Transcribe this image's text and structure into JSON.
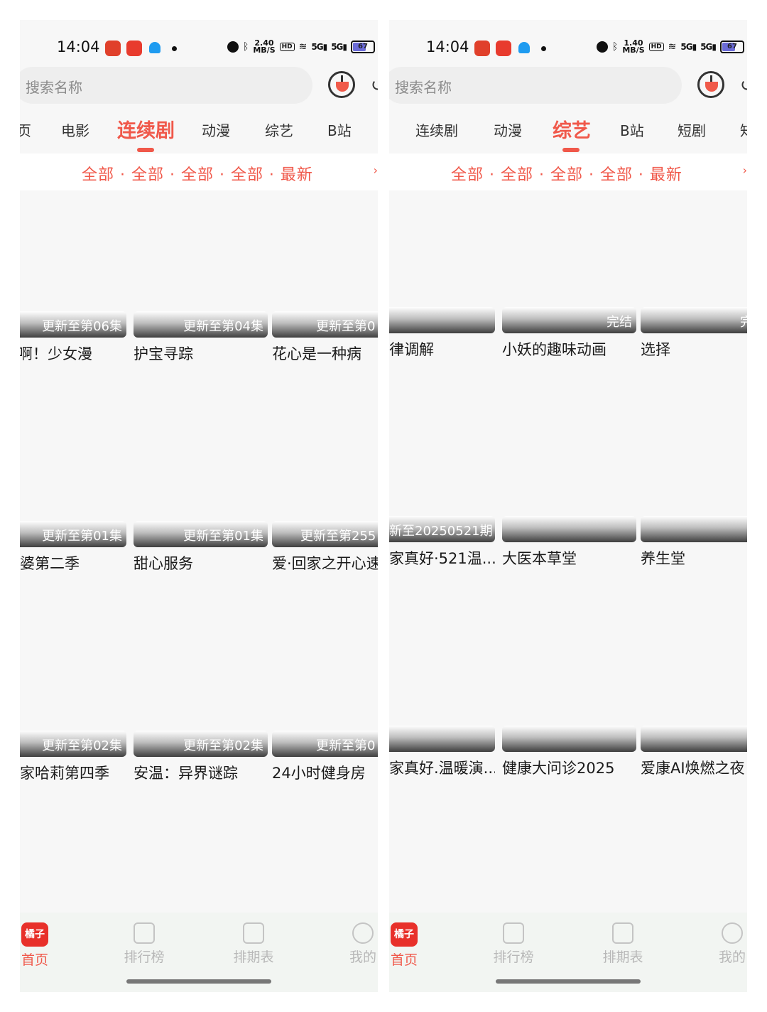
{
  "screens": [
    {
      "status": {
        "time": "14:04",
        "speed": "2.40",
        "speed_unit": "MB/S",
        "hd": "HD",
        "sig1": "5G",
        "sig2": "5G",
        "battery": "67"
      },
      "search": {
        "placeholder": "搜索名称"
      },
      "tabs": [
        {
          "label": "页",
          "active": false
        },
        {
          "label": "电影",
          "active": false
        },
        {
          "label": "连续剧",
          "active": true
        },
        {
          "label": "动漫",
          "active": false
        },
        {
          "label": "综艺",
          "active": false
        },
        {
          "label": "B站",
          "active": false
        }
      ],
      "filter": {
        "text": "全部 · 全部 · 全部 · 全部 · 最新",
        "more": "›"
      },
      "cards": [
        {
          "badge": "更新至第06集",
          "title": "啊！少女漫"
        },
        {
          "badge": "更新至第04集",
          "title": "护宝寻踪"
        },
        {
          "badge": "更新至第0",
          "title": "花心是一种病"
        },
        {
          "badge": "更新至第01集",
          "title": "婆第二季"
        },
        {
          "badge": "更新至第01集",
          "title": "甜心服务"
        },
        {
          "badge": "更新至第255",
          "title": "爱·回家之开心速"
        },
        {
          "badge": "更新至第02集",
          "title": "家哈莉第四季"
        },
        {
          "badge": "更新至第02集",
          "title": "安温：异界谜踪"
        },
        {
          "badge": "更新至第0",
          "title": "24小时健身房"
        }
      ],
      "nav": [
        {
          "logo": "橘子",
          "label": "首页",
          "active": true
        },
        {
          "label": "排行榜",
          "active": false
        },
        {
          "label": "排期表",
          "active": false
        },
        {
          "label": "我的",
          "active": false
        }
      ]
    },
    {
      "status": {
        "time": "14:04",
        "speed": "1.40",
        "speed_unit": "MB/S",
        "hd": "HD",
        "sig1": "5G",
        "sig2": "5G",
        "battery": "67"
      },
      "search": {
        "placeholder": "搜索名称"
      },
      "tabs": [
        {
          "label": "连续剧",
          "active": false
        },
        {
          "label": "动漫",
          "active": false
        },
        {
          "label": "综艺",
          "active": true
        },
        {
          "label": "B站",
          "active": false
        },
        {
          "label": "短剧",
          "active": false
        },
        {
          "label": "知",
          "active": false
        }
      ],
      "filter": {
        "text": "全部 · 全部 · 全部 · 全部 · 最新",
        "more": "›"
      },
      "cards": [
        {
          "badge": "",
          "title": "律调解"
        },
        {
          "badge": "完结",
          "title": "小妖的趣味动画"
        },
        {
          "badge": "完",
          "title": "选择"
        },
        {
          "badge": "新至20250521期",
          "title": "家真好·521温..."
        },
        {
          "badge": "",
          "title": "大医本草堂"
        },
        {
          "badge": "",
          "title": "养生堂"
        },
        {
          "badge": "",
          "title": "家真好.温暖演..."
        },
        {
          "badge": "",
          "title": "健康大问诊2025"
        },
        {
          "badge": "",
          "title": "爱康AI焕燃之夜"
        }
      ],
      "nav": [
        {
          "logo": "橘子",
          "label": "首页",
          "active": true
        },
        {
          "label": "排行榜",
          "active": false
        },
        {
          "label": "排期表",
          "active": false
        },
        {
          "label": "我的",
          "active": false
        }
      ]
    }
  ]
}
